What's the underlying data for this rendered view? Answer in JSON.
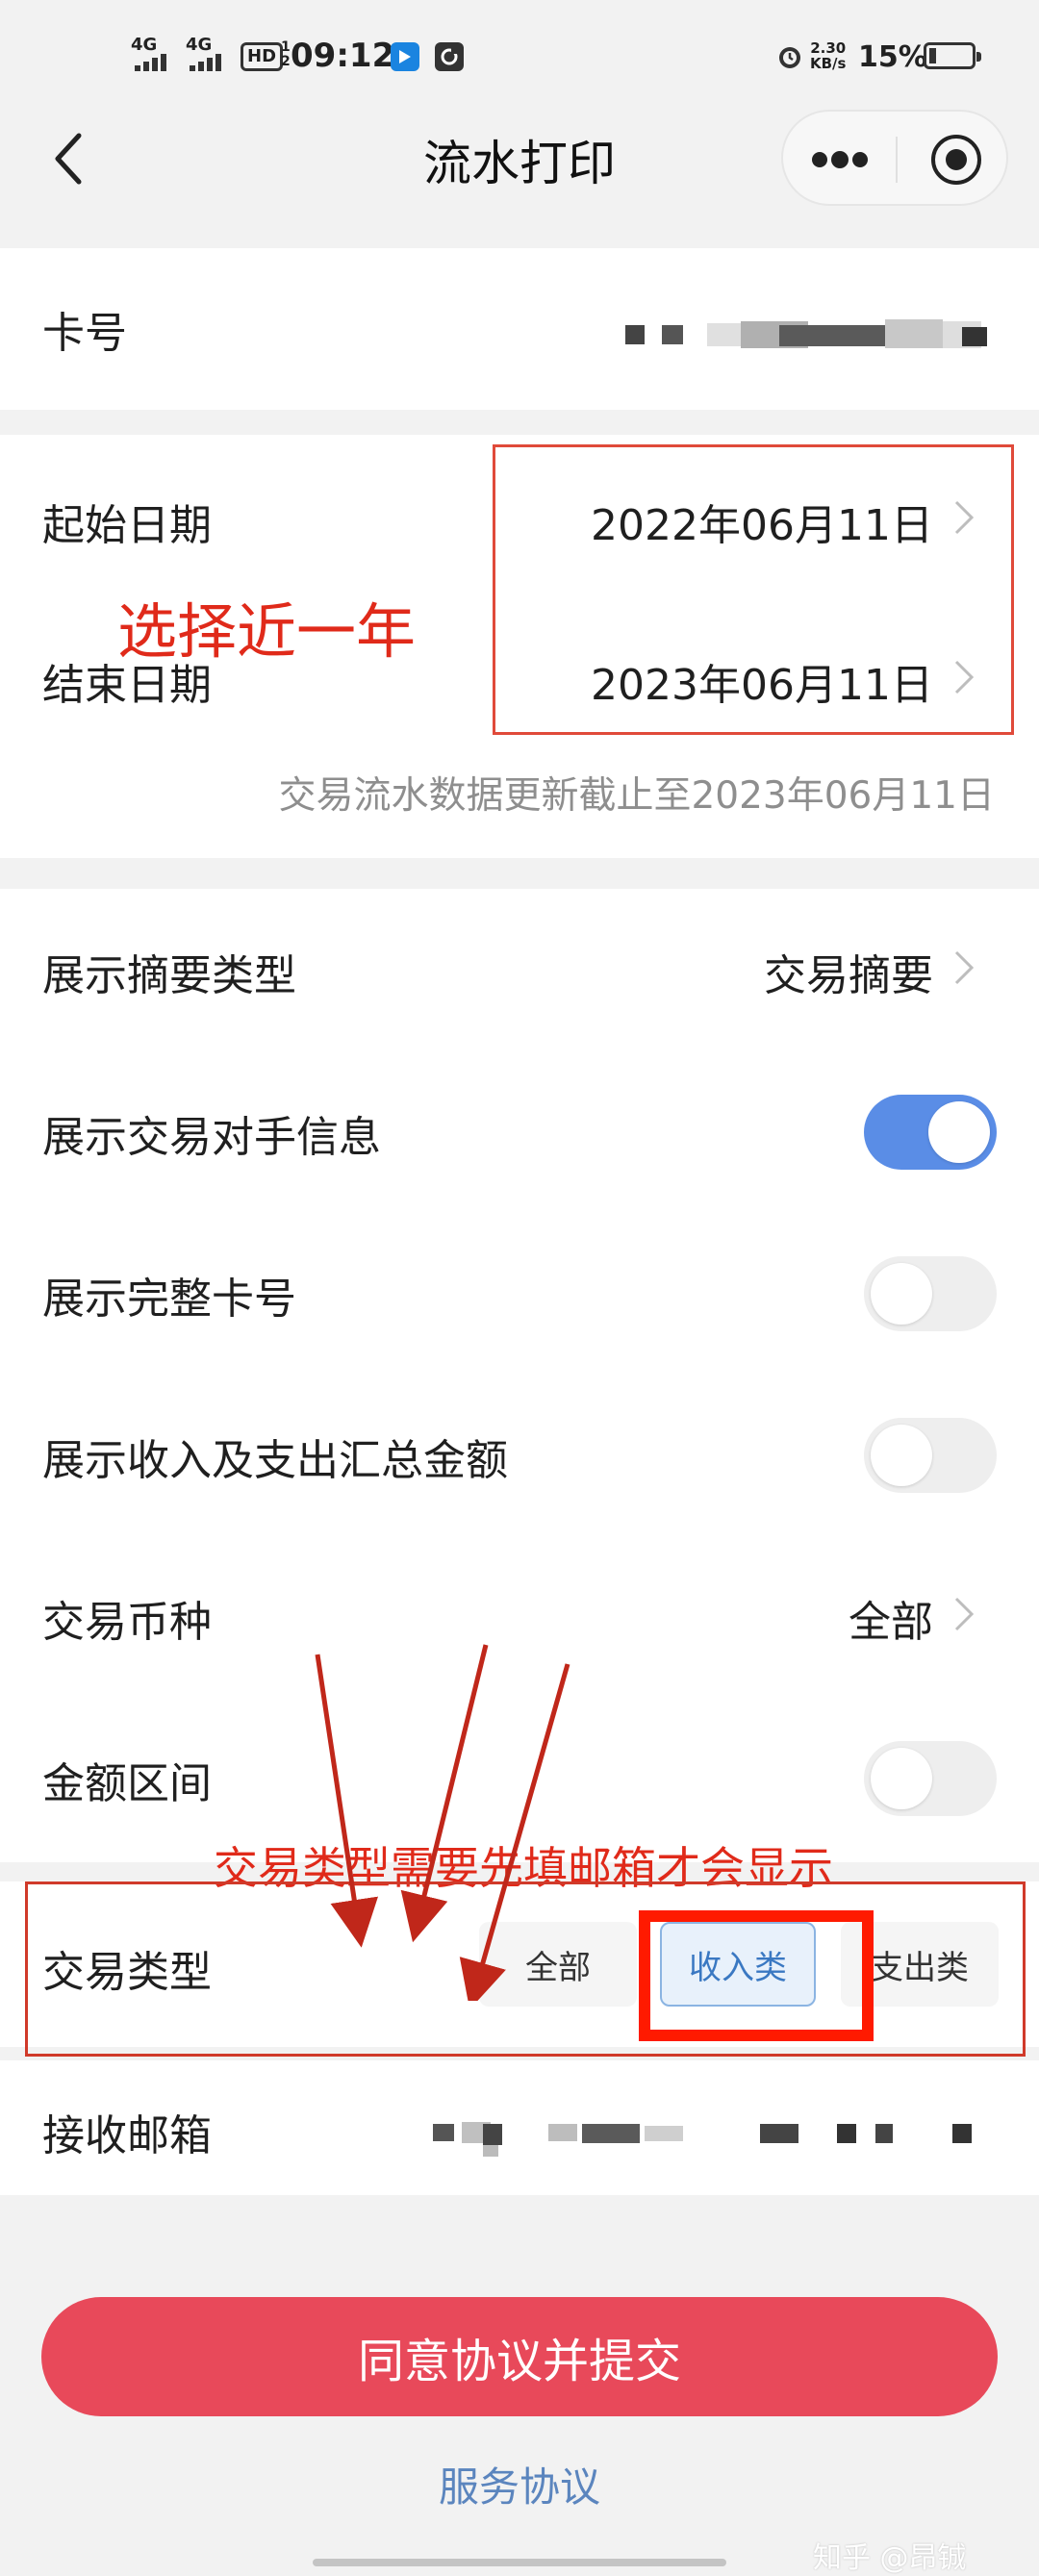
{
  "status_bar": {
    "network_1": "4G",
    "network_2": "4G",
    "hd": "HD",
    "hd_sub": "1 2",
    "time": "09:12",
    "speed_value": "2.30",
    "speed_unit": "KB/s",
    "battery_percent": "15%",
    "battery_level": 0.15
  },
  "nav": {
    "title": "流水打印",
    "more_icon": "ellipsis-icon",
    "close_icon": "target-icon"
  },
  "card_number": {
    "label": "卡号",
    "value_masked": true
  },
  "date_range": {
    "start_label": "起始日期",
    "start_value": "2022年06月11日",
    "end_label": "结束日期",
    "end_value": "2023年06月11日",
    "note": "交易流水数据更新截止至2023年06月11日"
  },
  "options": {
    "summary_type": {
      "label": "展示摘要类型",
      "value": "交易摘要"
    },
    "counterparty": {
      "label": "展示交易对手信息",
      "on": true
    },
    "full_card": {
      "label": "展示完整卡号",
      "on": false
    },
    "totals": {
      "label": "展示收入及支出汇总金额",
      "on": false
    },
    "currency": {
      "label": "交易币种",
      "value": "全部"
    },
    "amount_range": {
      "label": "金额区间",
      "on": false
    },
    "transaction_type": {
      "label": "交易类型",
      "options": [
        "全部",
        "收入类",
        "支出类"
      ],
      "selected": "收入类"
    },
    "email": {
      "label": "接收邮箱",
      "value_masked": true
    }
  },
  "annotations": {
    "date_hint": "选择近一年",
    "type_hint": "交易类型需要先填邮箱才会显示"
  },
  "actions": {
    "submit": "同意协议并提交",
    "service_agreement": "服务协议"
  },
  "watermark": "知乎 @昂铖",
  "colors": {
    "accent_blue": "#5a8de6",
    "submit_red": "#e8495a",
    "link_blue": "#5b85be",
    "annotation_red": "#e02a1a",
    "selected_chip_bg": "#e8f1fb",
    "selected_chip_text": "#3a78c2"
  }
}
